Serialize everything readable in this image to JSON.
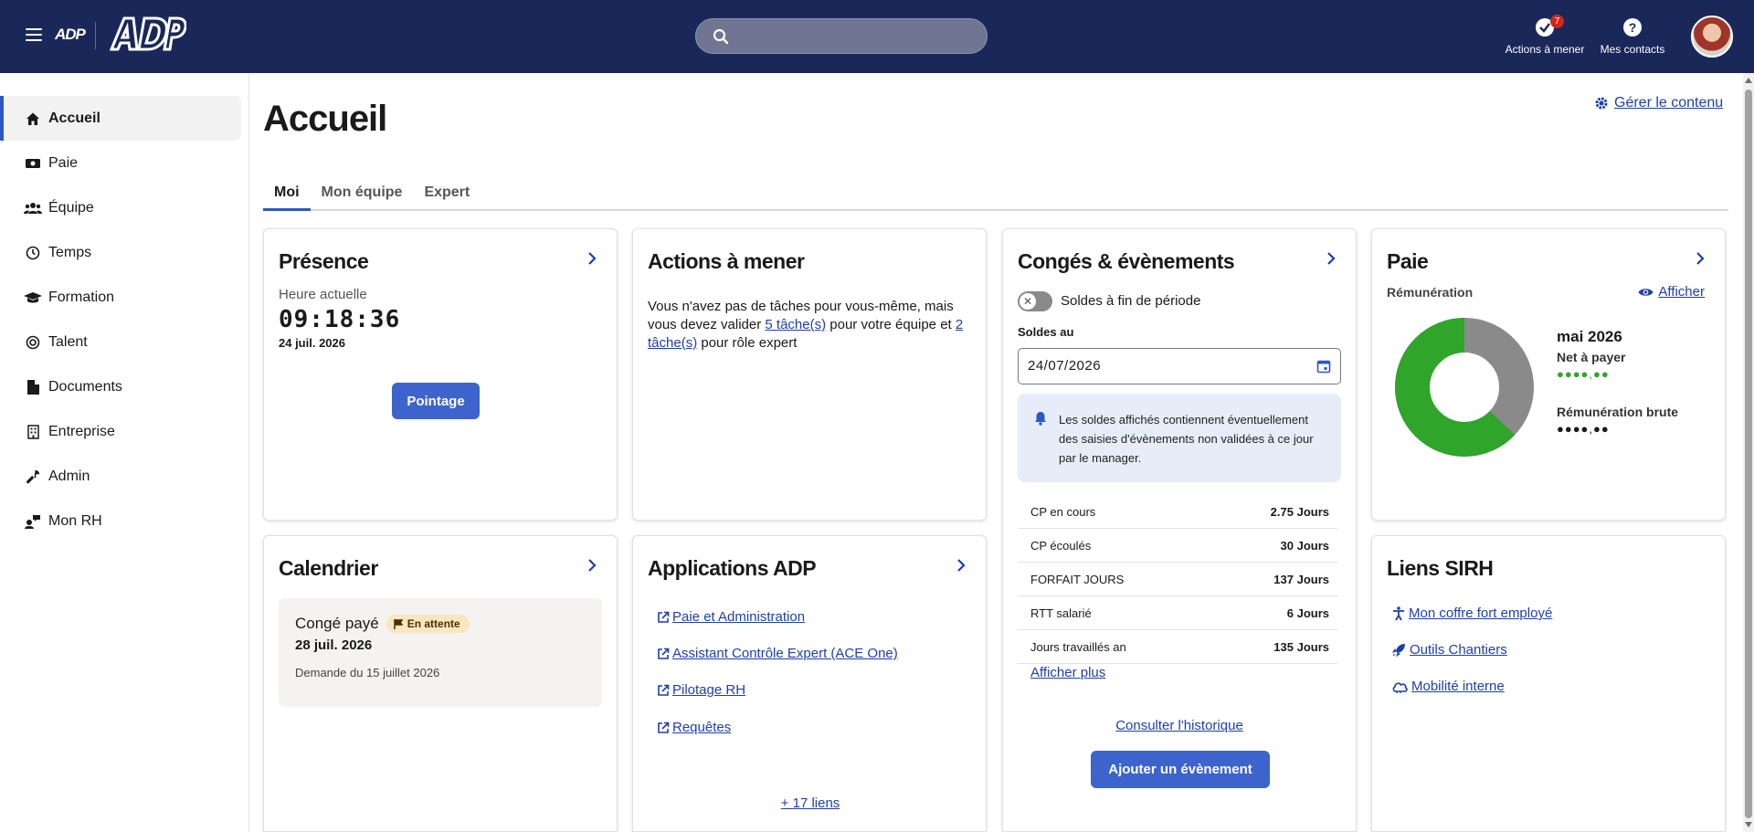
{
  "header": {
    "logo_small": "ADP",
    "logo_big": "ADP",
    "search_placeholder": "",
    "actions_label": "Actions à mener",
    "actions_badge": "7",
    "contacts_label": "Mes contacts"
  },
  "sidebar": {
    "items": [
      {
        "label": "Accueil",
        "icon": "home-icon"
      },
      {
        "label": "Paie",
        "icon": "money-icon"
      },
      {
        "label": "Équipe",
        "icon": "team-icon"
      },
      {
        "label": "Temps",
        "icon": "clock-icon"
      },
      {
        "label": "Formation",
        "icon": "graduation-cap-icon"
      },
      {
        "label": "Talent",
        "icon": "target-icon"
      },
      {
        "label": "Documents",
        "icon": "document-icon"
      },
      {
        "label": "Entreprise",
        "icon": "building-icon"
      },
      {
        "label": "Admin",
        "icon": "wrench-icon"
      },
      {
        "label": "Mon RH",
        "icon": "chat-user-icon"
      }
    ]
  },
  "main": {
    "title": "Accueil",
    "manage_link": "Gérer le contenu",
    "tabs": [
      {
        "label": "Moi"
      },
      {
        "label": "Mon équipe"
      },
      {
        "label": "Expert"
      }
    ]
  },
  "presence": {
    "title": "Présence",
    "subtitle": "Heure actuelle",
    "clock": "09:18:36",
    "date": "24 juil. 2026",
    "button": "Pointage"
  },
  "actions": {
    "title": "Actions à mener",
    "text_before": "Vous n'avez pas de tâches pour vous-même, mais vous devez valider ",
    "link1": "5 tâche(s)",
    "text_middle": " pour votre équipe et ",
    "link2": "2 tâche(s)",
    "text_after": " pour rôle expert"
  },
  "conges": {
    "title": "Congés & évènements",
    "toggle_label": "Soldes à fin de période",
    "toggle_on": false,
    "date_label": "Soldes au",
    "date_value": "24/07/2026",
    "info": "Les soldes affichés contiennent éventuellement des saisies d'évènements non validées à ce jour par le manager.",
    "balances": [
      {
        "label": "CP en cours",
        "value": "2.75 Jours"
      },
      {
        "label": "CP écoulés",
        "value": "30 Jours"
      },
      {
        "label": "FORFAIT JOURS",
        "value": "137 Jours"
      },
      {
        "label": "RTT salarié",
        "value": "6 Jours"
      },
      {
        "label": "Jours travaillés an",
        "value": "135 Jours"
      }
    ],
    "more": "Afficher plus",
    "history": "Consulter l'historique",
    "add_button": "Ajouter un évènement"
  },
  "paie": {
    "title": "Paie",
    "subtitle": "Rémunération",
    "show": "Afficher",
    "month": "mai 2026",
    "net_label": "Net à payer",
    "net_value": "●●●●,●●",
    "gross_label": "Rémunération brute",
    "gross_value": "●●●●,●●",
    "net_color": "#2fa52a",
    "gross_color": "#8a8a8a",
    "net_fraction": 0.63
  },
  "calendrier": {
    "title": "Calendrier",
    "type": "Congé payé",
    "status": "En attente",
    "date": "28 juil. 2026",
    "request": "Demande du 15 juillet 2026"
  },
  "apps": {
    "title": "Applications ADP",
    "links": [
      "Paie et Administration",
      "Assistant Contrôle Expert (ACE One)",
      "Pilotage RH",
      "Requêtes"
    ],
    "more": "+ 17 liens"
  },
  "sirh": {
    "title": "Liens SIRH",
    "links": [
      "Mon coffre fort employé",
      "Outils Chantiers",
      "Mobilité interne"
    ]
  },
  "colors": {
    "header_bg": "#1a2859",
    "accent": "#3d63cc",
    "link": "#1f3fa8"
  }
}
